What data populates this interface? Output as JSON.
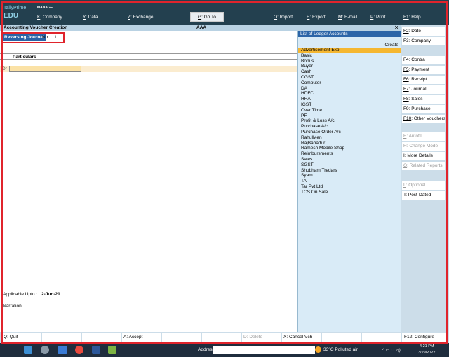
{
  "header": {
    "brand_line1": "TallyPrime",
    "brand_line2": "EDU",
    "manage_label": "MANAGE",
    "menu": [
      {
        "key": "K",
        "label": ": Company"
      },
      {
        "key": "Y",
        "label": ": Data"
      },
      {
        "key": "Z",
        "label": ": Exchange"
      },
      {
        "key": "G",
        "label": ": Go To"
      },
      {
        "key": "O",
        "label": ": Import"
      },
      {
        "key": "E",
        "label": ": Export"
      },
      {
        "key": "M",
        "label": ": E-mail"
      },
      {
        "key": "P",
        "label": ": Print"
      },
      {
        "key": "F1",
        "label": ": Help"
      }
    ]
  },
  "titlebar": {
    "title": "Accounting Voucher Creation",
    "company": "AAA",
    "close_icon": "close-icon"
  },
  "voucher": {
    "type": "Reversing Journal",
    "no_label": "No.",
    "no_value": "1",
    "particulars_header": "Particulars",
    "dr_label": "Dr",
    "applicable_label": "Applicable Upto :",
    "applicable_value": "2-Jun-21",
    "narration_label": "Narration:"
  },
  "ledger_panel": {
    "title": "List of Ledger Accounts",
    "create_label": "Create",
    "items": [
      "Advertisement Exp",
      "Basic",
      "Bonus",
      "Buyer",
      "Cash",
      "CGST",
      "Computer",
      "DA",
      "HDFC",
      "HRA",
      "IGST",
      "Over Time",
      "PF",
      "Profit & Loss A/c",
      "Purchase A/c",
      "Purchase Order A/c",
      "RahulMen",
      "RajBahadur",
      "Ramesh Mobile Shop",
      "Reimbursments",
      "Sales",
      "SGST",
      "Shubham Tredars",
      "Syam",
      "TA",
      "Tar Pvt Ltd",
      "TCS On Sale"
    ],
    "selected_index": 0
  },
  "right_buttons": [
    {
      "key": "F2",
      "label": ": Date",
      "enabled": true
    },
    {
      "key": "F3",
      "label": ": Company",
      "enabled": true
    },
    {
      "key": "F4",
      "label": ": Contra",
      "enabled": true
    },
    {
      "key": "F5",
      "label": ": Payment",
      "enabled": true
    },
    {
      "key": "F6",
      "label": ": Receipt",
      "enabled": true
    },
    {
      "key": "F7",
      "label": ": Journal",
      "enabled": true
    },
    {
      "key": "F8",
      "label": ": Sales",
      "enabled": true
    },
    {
      "key": "F9",
      "label": ": Purchase",
      "enabled": true
    },
    {
      "key": "F10",
      "label": ": Other Vouchers",
      "enabled": true
    },
    {
      "key": "E",
      "label": ": Autofill",
      "enabled": false
    },
    {
      "key": "H",
      "label": ": Change Mode",
      "enabled": false
    },
    {
      "key": "I",
      "label": ": More Details",
      "enabled": true
    },
    {
      "key": "O",
      "label": ": Related Reports",
      "enabled": false
    },
    {
      "key": "L",
      "label": ": Optional",
      "enabled": false
    },
    {
      "key": "T",
      "label": ": Post-Dated",
      "enabled": true
    }
  ],
  "bottom_buttons": [
    {
      "key": "Q",
      "label": ": Quit",
      "enabled": true
    },
    {
      "key": "",
      "label": "",
      "enabled": true
    },
    {
      "key": "",
      "label": "",
      "enabled": true
    },
    {
      "key": "A",
      "label": ": Accept",
      "enabled": true
    },
    {
      "key": "",
      "label": "",
      "enabled": true
    },
    {
      "key": "",
      "label": "",
      "enabled": true
    },
    {
      "key": "D",
      "label": ": Delete",
      "enabled": false
    },
    {
      "key": "X",
      "label": ": Cancel Vch",
      "enabled": true
    },
    {
      "key": "",
      "label": "",
      "enabled": true
    },
    {
      "key": "",
      "label": "",
      "enabled": true
    }
  ],
  "configure_button": {
    "key": "F12",
    "label": ": Configure"
  },
  "taskbar": {
    "address_label": "Address",
    "weather": "33°C  Polluted air",
    "time": "4:21 PM",
    "date": "3/29/2022",
    "tray": "^ ▭ ⌔ ◁)"
  },
  "colors": {
    "header_bg": "#23404f",
    "titlebar_bg": "#b9d2e3",
    "selection": "#f5b731",
    "panel_bg": "#d9ebf7",
    "highlight_box": "#e0242c"
  }
}
